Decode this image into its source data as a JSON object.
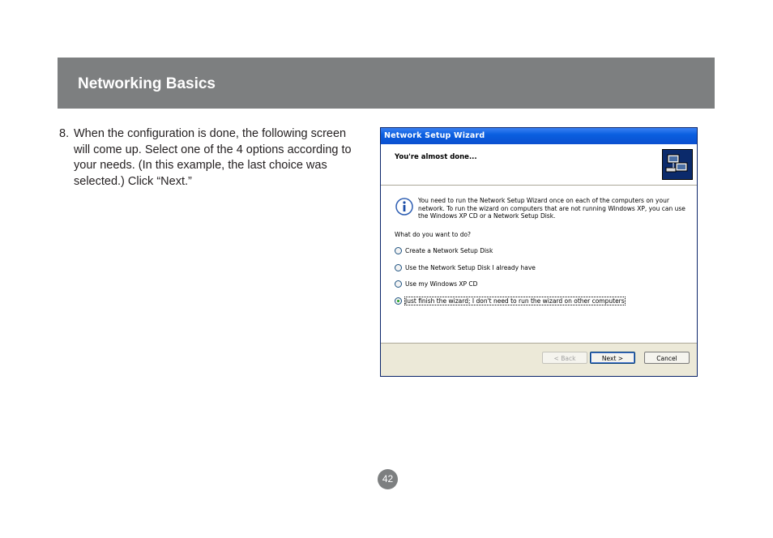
{
  "header": {
    "title": "Networking Basics"
  },
  "step": {
    "number": "8.",
    "text": "When the configuration is done, the following screen will come up. Select one of the 4 options according to your needs.  (In this example, the last choice was selected.) Click “Next.”"
  },
  "wizard": {
    "window_title": "Network Setup Wizard",
    "header_title": "You're almost done...",
    "info_text": "You need to run the Network Setup Wizard once on each of the computers on your network. To run the wizard on computers that are not running Windows XP, you can use the Windows XP CD or a Network Setup Disk.",
    "question": "What do you want to do?",
    "options": [
      {
        "label": "Create a Network Setup Disk",
        "selected": false
      },
      {
        "label": "Use the Network Setup Disk I already have",
        "selected": false
      },
      {
        "label": "Use my Windows XP CD",
        "selected": false
      },
      {
        "label": "Just finish the wizard; I don't need to run the wizard on other computers",
        "selected": true
      }
    ],
    "buttons": {
      "back": "< Back",
      "next": "Next >",
      "cancel": "Cancel"
    },
    "icons": {
      "info": "info-icon",
      "wizard": "network-computers-icon"
    }
  },
  "footer": {
    "page_number": "42"
  },
  "colors": {
    "header_band": "#7d7f80",
    "titlebar": "#0b4fd0",
    "page_badge": "#7d7f80"
  }
}
